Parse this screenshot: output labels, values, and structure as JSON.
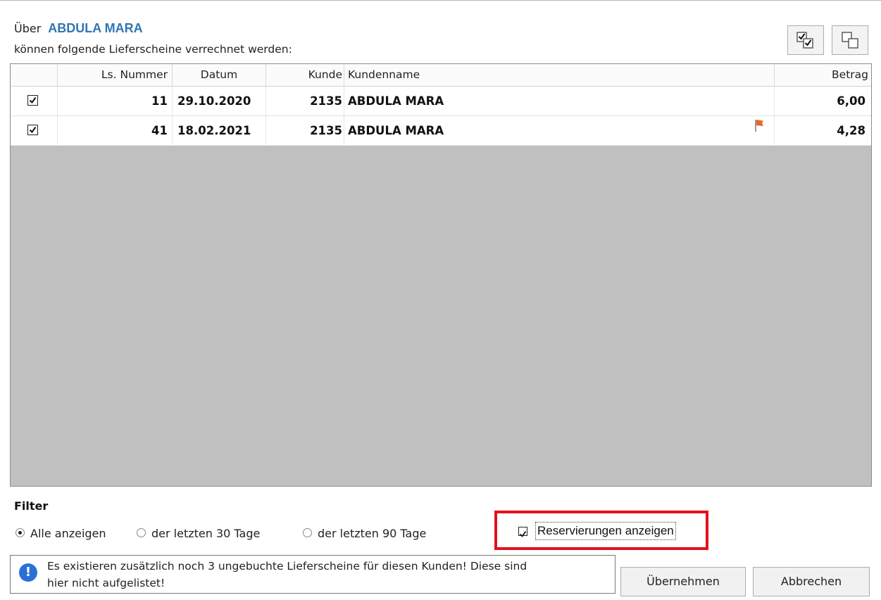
{
  "header": {
    "prefix": "Über",
    "customer": "ABDULA MARA",
    "subtitle": "können folgende Lieferscheine verrechnet werden:"
  },
  "toolbar": {
    "select_all_icon": "check-all-icon",
    "deselect_icon": "uncheck-all-icon"
  },
  "table": {
    "columns": {
      "ls_nummer": "Ls. Nummer",
      "datum": "Datum",
      "kunde": "Kunde",
      "kundenname": "Kundenname",
      "betrag": "Betrag"
    },
    "rows": [
      {
        "checked": true,
        "ls_nummer": "11",
        "datum": "29.10.2020",
        "kunde": "2135",
        "kundenname": "ABDULA MARA",
        "flag": false,
        "betrag": "6,00"
      },
      {
        "checked": true,
        "ls_nummer": "41",
        "datum": "18.02.2021",
        "kunde": "2135",
        "kundenname": "ABDULA MARA",
        "flag": true,
        "betrag": "4,28"
      }
    ]
  },
  "filter": {
    "title": "Filter",
    "options": [
      {
        "label": "Alle anzeigen",
        "selected": true
      },
      {
        "label": "der letzten 30 Tage",
        "selected": false
      },
      {
        "label": "der letzten 90 Tage",
        "selected": false
      }
    ],
    "reservations": {
      "label": "Reservierungen anzeigen",
      "checked": true
    }
  },
  "info": {
    "icon": "exclamation-info-icon",
    "text_line1": "Es existieren zusätzlich noch 3 ungebuchte Lieferscheine für diesen Kunden! Diese sind",
    "text_line2": "hier nicht aufgelistet!"
  },
  "buttons": {
    "apply": "Übernehmen",
    "cancel": "Abbrechen"
  },
  "colors": {
    "customer_name": "#2f75b5",
    "highlight": "#e3111d",
    "grid_background": "#c0c0c0",
    "info_icon": "#2a6fd6",
    "flag": "#e8662e"
  }
}
